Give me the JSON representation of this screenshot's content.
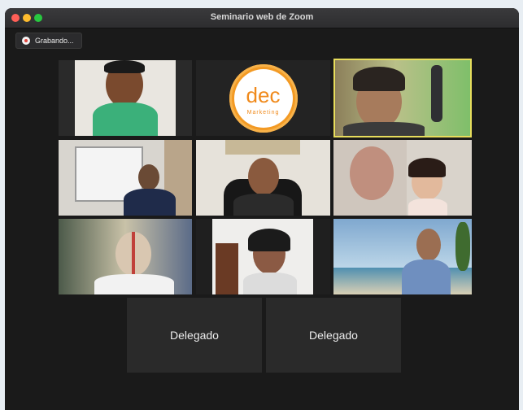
{
  "window": {
    "title": "Seminario web de Zoom"
  },
  "recording": {
    "label": "Grabando..."
  },
  "logo": {
    "text": "dec",
    "subtext": "Marketing"
  },
  "participants": [
    {
      "id": "p1",
      "label": ""
    },
    {
      "id": "p2",
      "label": ""
    },
    {
      "id": "p3",
      "label": ""
    },
    {
      "id": "p4",
      "label": ""
    },
    {
      "id": "p5",
      "label": ""
    },
    {
      "id": "p6",
      "label": ""
    },
    {
      "id": "p7",
      "label": ""
    },
    {
      "id": "p8",
      "label": ""
    },
    {
      "id": "p9",
      "label": ""
    }
  ],
  "delegates": [
    {
      "label": "Delegado"
    },
    {
      "label": "Delegado"
    }
  ],
  "colors": {
    "active_speaker": "#e7dd5c",
    "window_bg": "#1a1a1a",
    "tile_bg": "#232323",
    "logo_orange": "#f39a24"
  }
}
